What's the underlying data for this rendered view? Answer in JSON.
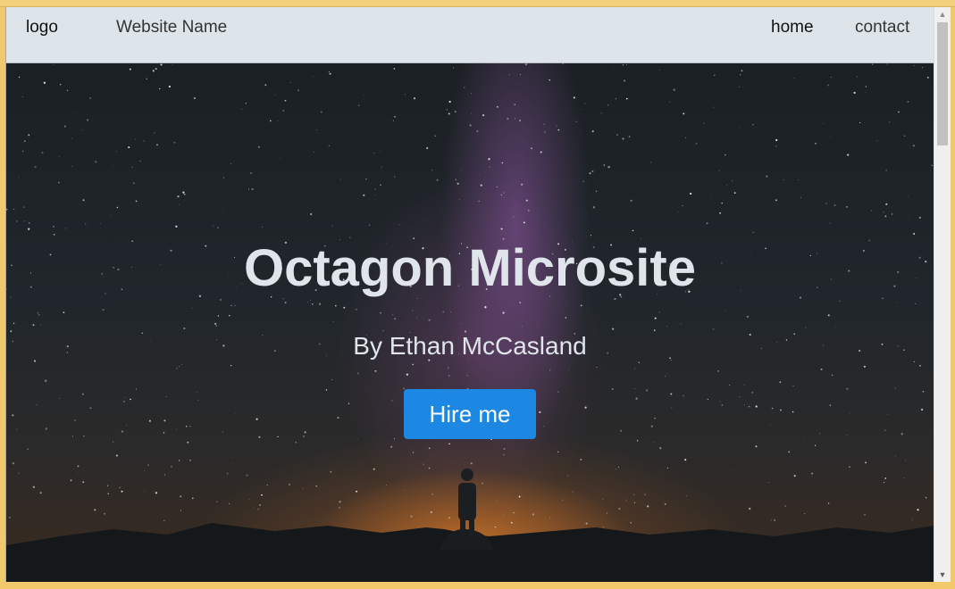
{
  "nav": {
    "logo": "logo",
    "site_name": "Website Name",
    "home": "home",
    "contact": "contact"
  },
  "hero": {
    "title": "Octagon Microsite",
    "subtitle": "By Ethan McCasland",
    "cta_label": "Hire me"
  },
  "colors": {
    "navbar_bg": "#dee5ea",
    "button_bg": "#1d87e4",
    "title_text": "#dfe5ea"
  },
  "icons": {
    "scroll_up": "scroll-up-arrow-icon",
    "scroll_down": "scroll-down-arrow-icon"
  }
}
